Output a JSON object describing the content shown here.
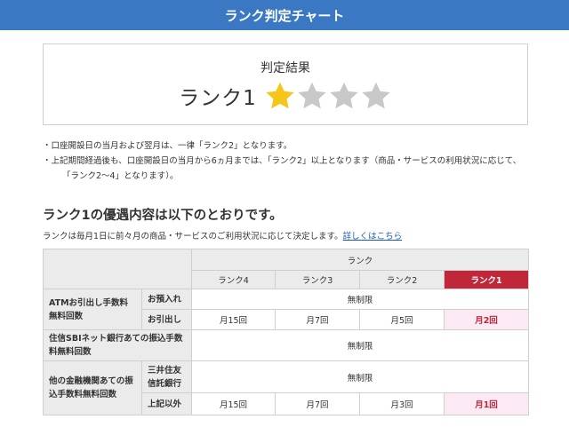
{
  "header": {
    "title": "ランク判定チャート"
  },
  "result": {
    "heading": "判定結果",
    "rank_label": "ランク1",
    "stars_filled": 1,
    "stars_total": 4,
    "star_filled_color": "#f5c518",
    "star_empty_color": "#c8c8c8"
  },
  "notes": [
    "・口座開設日の当月および翌月は、一律「ランク2」となります。",
    "・上記期間経過後も、口座開設日の当月から6ヵ月までは、「ランク2」以上となります（商品・サービスの利用状況に応じて、",
    "「ランク2〜4」となります）。"
  ],
  "benefits": {
    "heading": "ランク1の優遇内容は以下のとおりです。",
    "description": "ランクは毎月1日に前々月の商品・サービスのご利用状況に応じて決定します。",
    "link_text": "詳しくはこちら"
  },
  "table": {
    "rank_header": "ランク",
    "rank_columns": [
      "ランク4",
      "ランク3",
      "ランク2",
      "ランク1"
    ],
    "active_color": "#c0283a",
    "rows": {
      "atm": {
        "label": "ATMお引出し手数料無料回数",
        "deposit_label": "お預入れ",
        "deposit_value": "無制限",
        "withdraw_label": "お引出し",
        "withdraw_values": [
          "月15回",
          "月7回",
          "月5回",
          "月2回"
        ]
      },
      "sbi": {
        "label": "住信SBIネット銀行あての振込手数料無料回数",
        "value": "無制限"
      },
      "other": {
        "label": "他の金融機関あての振込手数料無料回数",
        "smtb_label": "三井住友信託銀行",
        "smtb_value": "無制限",
        "others_label": "上記以外",
        "others_values": [
          "月15回",
          "月7回",
          "月3回",
          "月1回"
        ]
      }
    }
  }
}
